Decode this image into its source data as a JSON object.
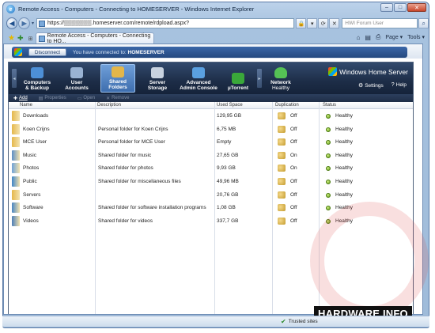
{
  "window": {
    "title": "Remote Access - Computers - Connecting to HOMESERVER - Windows Internet Explorer",
    "controls": {
      "minimize": "–",
      "maximize": "□",
      "close": "✕"
    }
  },
  "address_bar": {
    "back": "◀",
    "forward": "▶",
    "url": "https://▒▒▒▒▒▒▒.homeserver.com/remote/rdpload.aspx?",
    "search_placeholder": "HWI Forum User",
    "search_go": "⌕"
  },
  "tabs": {
    "active_label": "Remote Access - Computers - Connecting to HO...",
    "command_bar": {
      "home": "⌂",
      "feeds": "▤",
      "print": "⎙",
      "page": "Page ▾",
      "tools": "Tools ▾"
    }
  },
  "rdp": {
    "disconnect_label": "Disconnect",
    "connected_prefix": "You have connected to:",
    "server": "HOMESERVER"
  },
  "whs": {
    "nav": [
      {
        "label1": "Computers",
        "label2": "& Backup",
        "icon": "computers-icon",
        "color": "#4d8fd6"
      },
      {
        "label1": "User",
        "label2": "Accounts",
        "icon": "users-icon",
        "color": "#9ab3d3"
      },
      {
        "label1": "Shared",
        "label2": "Folders",
        "icon": "shared-folders-icon",
        "color": "#e3b64a"
      },
      {
        "label1": "Server",
        "label2": "Storage",
        "icon": "server-storage-icon",
        "color": "#c8d2df"
      },
      {
        "label1": "Advanced",
        "label2": "Admin Console",
        "icon": "admin-console-icon",
        "color": "#5aa0e0"
      },
      {
        "label1": "µTorrent",
        "label2": "",
        "icon": "utorrent-icon",
        "color": "#3aa83a"
      },
      {
        "label1": "Network",
        "label2": "Healthy",
        "icon": "network-icon",
        "color": "#55c255"
      }
    ],
    "brand": "Windows Home Server",
    "settings": "Settings",
    "help": "Help",
    "toolbar": {
      "add": "Add",
      "properties": "Properties",
      "open": "Open",
      "remove": "Remove"
    },
    "columns": {
      "name": "Name",
      "description": "Description",
      "used_space": "Used Space",
      "duplication": "Duplication",
      "status": "Status"
    },
    "rows": [
      {
        "name": "Downloads",
        "description": "",
        "used": "129,95 GB",
        "dup": "Off",
        "status": "Healthy",
        "color": "#e5b84a"
      },
      {
        "name": "Koen Crijns",
        "description": "Personal folder for Koen Crijns",
        "used": "6,75 MB",
        "dup": "Off",
        "status": "Healthy",
        "color": "#e5b84a"
      },
      {
        "name": "MCE User",
        "description": "Personal folder for MCE User",
        "used": "Empty",
        "dup": "Off",
        "status": "Healthy",
        "color": "#e5b84a"
      },
      {
        "name": "Music",
        "description": "Shared folder for music",
        "used": "27,65 GB",
        "dup": "On",
        "status": "Healthy",
        "color": "#5d8fc7"
      },
      {
        "name": "Photos",
        "description": "Shared folder for photos",
        "used": "9,93 GB",
        "dup": "On",
        "status": "Healthy",
        "color": "#6fa3d8"
      },
      {
        "name": "Public",
        "description": "Shared folder for miscellaneous files",
        "used": "49,96 MB",
        "dup": "Off",
        "status": "Healthy",
        "color": "#3f86c9"
      },
      {
        "name": "Servers",
        "description": "",
        "used": "20,76 GB",
        "dup": "Off",
        "status": "Healthy",
        "color": "#e5b84a"
      },
      {
        "name": "Software",
        "description": "Shared folder for software installation programs",
        "used": "1,08 GB",
        "dup": "Off",
        "status": "Healthy",
        "color": "#4a86c3"
      },
      {
        "name": "Videos",
        "description": "Shared folder for videos",
        "used": "337,7 GB",
        "dup": "Off",
        "status": "Healthy",
        "color": "#4d7fb8"
      }
    ]
  },
  "status_bar": {
    "trusted": "Trusted sites"
  },
  "watermark": {
    "text_a": "HARDWARE",
    "dot": ".",
    "text_b": "INFO"
  }
}
